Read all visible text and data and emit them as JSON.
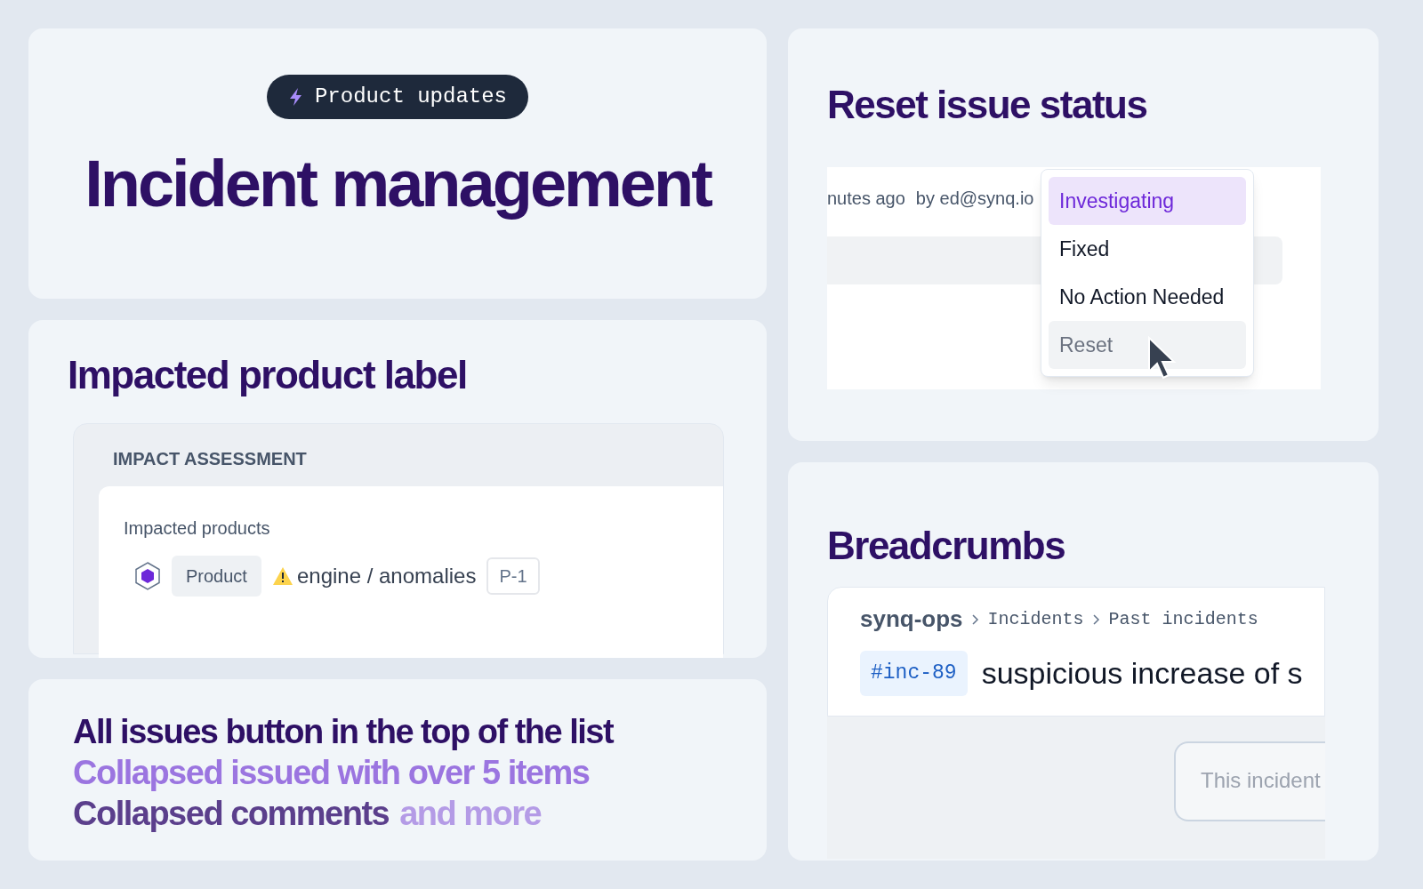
{
  "header_card": {
    "badge": "Product updates",
    "title": "Incident management"
  },
  "impact_card": {
    "heading": "Impacted product label",
    "section": "IMPACT ASSESSMENT",
    "field_label": "Impacted products",
    "tag": "Product",
    "product": "engine / anomalies",
    "priority": "P-1"
  },
  "features": [
    [
      {
        "text": "All issues button in the top of the list",
        "color": "#2e1065"
      }
    ],
    [
      {
        "text": "Collapsed issued with over 5 items",
        "color": "#9b75e0"
      }
    ],
    [
      {
        "text": "Collapsed comments",
        "color": "#5b3f8c"
      },
      {
        "text": "and more",
        "color": "#b49be6"
      }
    ]
  ],
  "status_card": {
    "heading": "Reset issue status",
    "meta": [
      "nutes ago",
      "by ed@synq.io"
    ],
    "menu": [
      {
        "label": "Investigating",
        "selected": true,
        "hovered": false
      },
      {
        "label": "Fixed",
        "selected": false,
        "hovered": false
      },
      {
        "label": "No Action Needed",
        "selected": false,
        "hovered": false
      },
      {
        "label": "Reset",
        "selected": false,
        "hovered": true
      }
    ]
  },
  "breadcrumbs_card": {
    "heading": "Breadcrumbs",
    "crumbs": [
      "synq-ops",
      "Incidents",
      "Past incidents"
    ],
    "incident_id": "#inc-89",
    "incident_title": "suspicious increase of s",
    "note": "This incident"
  }
}
